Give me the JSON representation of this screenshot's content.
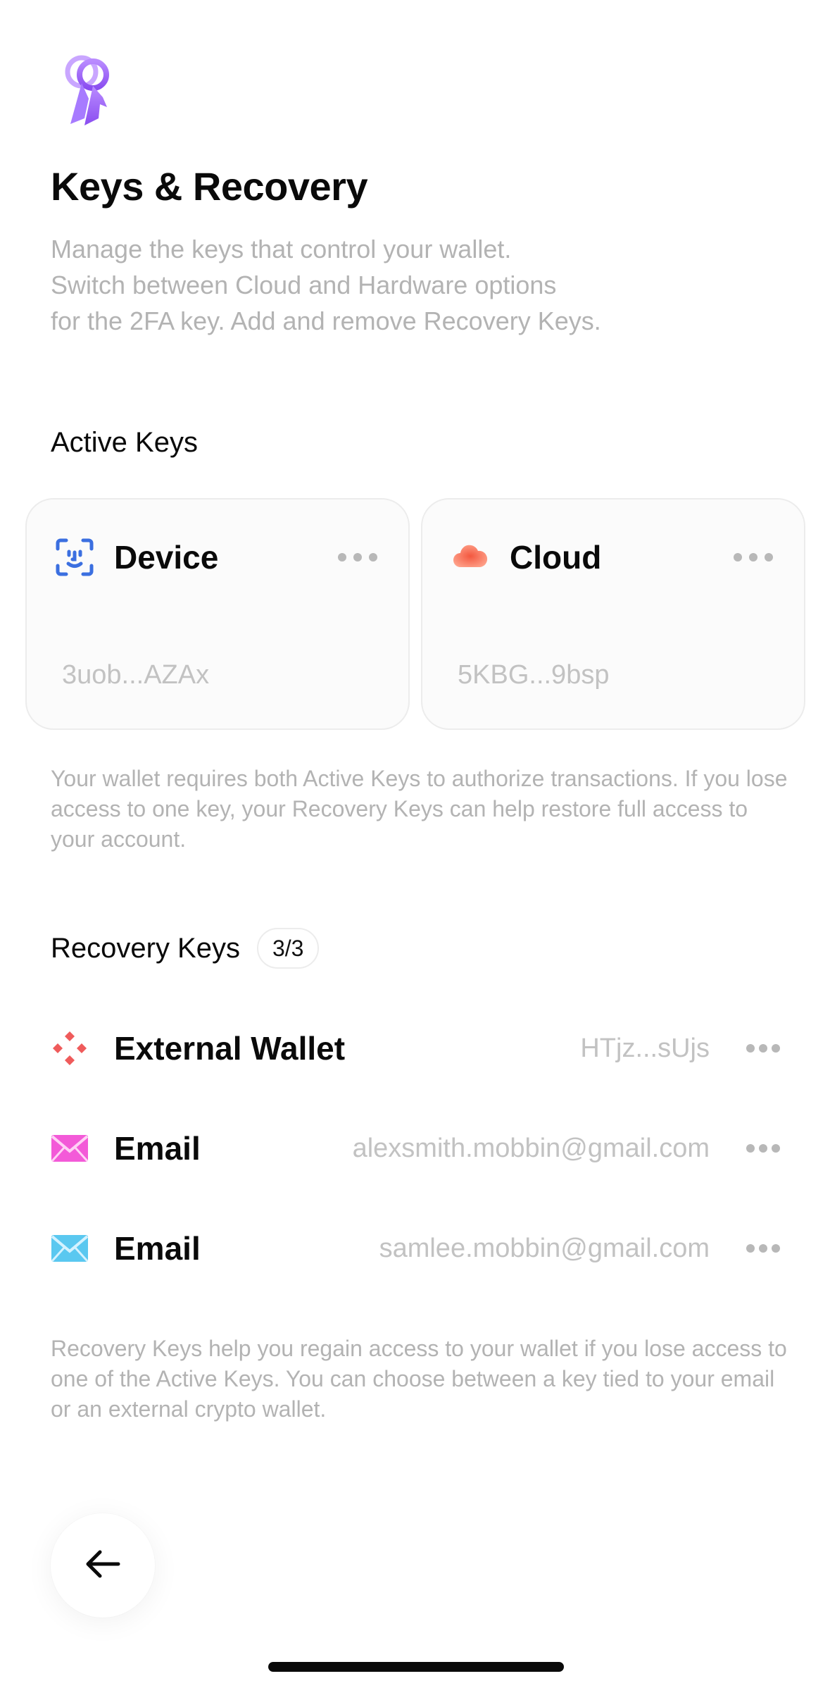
{
  "header": {
    "icon": "keys-icon",
    "title": "Keys & Recovery",
    "subtitle": "Manage the keys that control your wallet.\nSwitch between Cloud and Hardware options\nfor the 2FA key. Add and remove Recovery Keys."
  },
  "active_keys": {
    "section_title": "Active Keys",
    "cards": [
      {
        "icon": "face-id-icon",
        "name": "Device",
        "address": "3uob...AZAx"
      },
      {
        "icon": "cloud-icon",
        "name": "Cloud",
        "address": "5KBG...9bsp"
      }
    ],
    "note": "Your wallet requires both Active Keys to authorize transactions. If you lose access to one key, your Recovery Keys can help restore full access to your account."
  },
  "recovery_keys": {
    "section_title": "Recovery Keys",
    "count": "3/3",
    "items": [
      {
        "icon": "external-wallet-icon",
        "name": "External Wallet",
        "value": "HTjz...sUjs"
      },
      {
        "icon": "email-icon",
        "name": "Email",
        "value": "alexsmith.mobbin@gmail.com"
      },
      {
        "icon": "email-icon",
        "name": "Email",
        "value": "samlee.mobbin@gmail.com"
      }
    ],
    "note": "Recovery Keys help you regain access to your wallet if you lose access to one of the Active Keys. You can choose between a key tied to your email or an external crypto wallet."
  },
  "navigation": {
    "back_icon": "arrow-left-icon"
  },
  "colors": {
    "device_icon": "#3b6fe0",
    "cloud_icon": "#f2583a",
    "wallet_icon": "#ef5b5b",
    "email_pink": "#f35ad8",
    "email_cyan": "#5ac8f0",
    "keys_icon": "#9b5cf5"
  }
}
